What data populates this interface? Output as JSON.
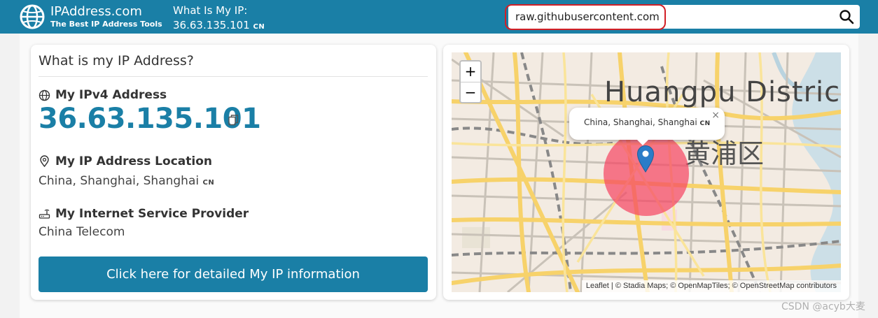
{
  "header": {
    "brand_name": "IPAddress.com",
    "brand_tagline": "The Best IP Address Tools",
    "ip_label": "What Is My IP:",
    "ip_value": "36.63.135.101",
    "ip_country": "CN",
    "logo_icon": "globe-logo-icon",
    "search_icon": "search-icon"
  },
  "search": {
    "value": "raw.githubusercontent.com",
    "placeholder": ""
  },
  "card": {
    "title": "What is my IP Address?",
    "ipv4_heading": "My IPv4 Address",
    "ipv4_value": "36.63.135.101",
    "location_heading": "My IP Address Location",
    "location_value": "China, Shanghai, Shanghai",
    "location_country": "CN",
    "isp_heading": "My Internet Service Provider",
    "isp_value": "China Telecom",
    "detail_button": "Click here for detailed My IP information",
    "icons": [
      "globe-icon",
      "copy-icon",
      "location-pin-icon",
      "router-icon"
    ]
  },
  "map": {
    "zoom_in": "+",
    "zoom_out": "−",
    "district_en": "Huangpu Distric",
    "district_zh": "黄浦区",
    "popup_text": "China, Shanghai, Shanghai",
    "popup_country": "CN",
    "popup_close": "×",
    "attribution_leaflet": "Leaflet",
    "attribution_rest": " | © Stadia Maps; © OpenMapTiles; © OpenStreetMap contributors"
  },
  "watermark": "CSDN @acyb大麦",
  "colors": {
    "header_bg": "#1a7fa6",
    "accent": "#1a7fa6",
    "highlight_outline": "#d21f26",
    "map_circle": "#f54664",
    "map_pin": "#2b7cc8"
  }
}
